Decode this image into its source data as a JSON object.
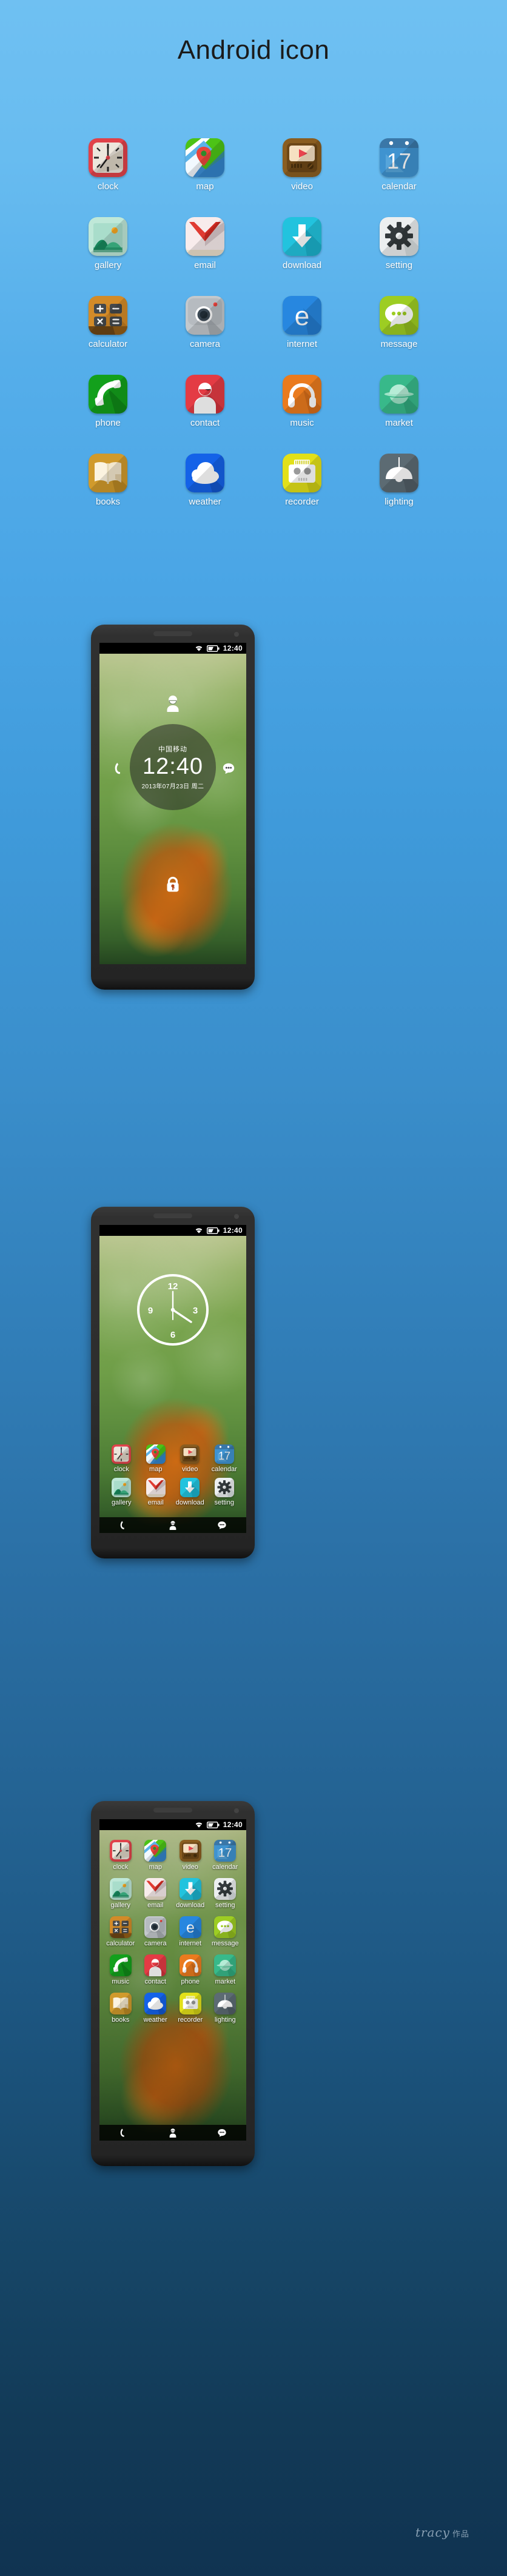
{
  "page": {
    "title": "Android icon",
    "signature": "tracy",
    "signature_suffix": "作品",
    "bg_top_color": "#6fc0f2",
    "bg_bottom_color": "#103351"
  },
  "icon_grid": {
    "rows": [
      [
        {
          "label": "clock",
          "icon": "clock-icon"
        },
        {
          "label": "map",
          "icon": "map-icon"
        },
        {
          "label": "video",
          "icon": "video-icon"
        },
        {
          "label": "calendar",
          "icon": "calendar-icon",
          "badge": "17"
        }
      ],
      [
        {
          "label": "gallery",
          "icon": "gallery-icon"
        },
        {
          "label": "email",
          "icon": "email-icon"
        },
        {
          "label": "download",
          "icon": "download-icon"
        },
        {
          "label": "setting",
          "icon": "setting-icon"
        }
      ],
      [
        {
          "label": "calculator",
          "icon": "calculator-icon"
        },
        {
          "label": "camera",
          "icon": "camera-icon"
        },
        {
          "label": "internet",
          "icon": "internet-icon"
        },
        {
          "label": "message",
          "icon": "message-icon"
        }
      ],
      [
        {
          "label": "phone",
          "icon": "phone-icon"
        },
        {
          "label": "contact",
          "icon": "contact-icon"
        },
        {
          "label": "music",
          "icon": "music-icon"
        },
        {
          "label": "market",
          "icon": "market-icon"
        }
      ],
      [
        {
          "label": "books",
          "icon": "books-icon"
        },
        {
          "label": "weather",
          "icon": "weather-icon"
        },
        {
          "label": "recorder",
          "icon": "recorder-icon"
        },
        {
          "label": "lighting",
          "icon": "lighting-icon"
        }
      ]
    ]
  },
  "status_bar": {
    "time": "12:40",
    "wifi_icon": "wifi-icon",
    "battery_icon": "battery-half-icon"
  },
  "phone_lockscreen": {
    "carrier": "中国移动",
    "time": "12:40",
    "date": "2013年07月23日  周二",
    "avatar_icon": "user-avatar-icon",
    "left_shortcut_icon": "phone-handset-icon",
    "right_shortcut_icon": "message-bubble-icon",
    "unlock_icon": "lock-icon"
  },
  "phone_home": {
    "widget": {
      "type": "analog-clock",
      "marks": [
        "12",
        "3",
        "6",
        "9"
      ],
      "hour_angle_deg": 120,
      "minute_angle_deg": 0
    },
    "apps": [
      {
        "label": "clock",
        "icon": "clock-icon"
      },
      {
        "label": "map",
        "icon": "map-icon"
      },
      {
        "label": "video",
        "icon": "video-icon"
      },
      {
        "label": "calendar",
        "icon": "calendar-icon",
        "badge": "17"
      },
      {
        "label": "gallery",
        "icon": "gallery-icon"
      },
      {
        "label": "email",
        "icon": "email-icon"
      },
      {
        "label": "download",
        "icon": "download-icon"
      },
      {
        "label": "setting",
        "icon": "setting-icon"
      }
    ],
    "navbar": [
      {
        "name": "nav-phone",
        "icon": "phone-handset-icon"
      },
      {
        "name": "nav-contact",
        "icon": "user-avatar-icon"
      },
      {
        "name": "nav-message",
        "icon": "message-bubble-icon"
      }
    ]
  },
  "phone_drawer": {
    "apps": [
      {
        "label": "clock",
        "icon": "clock-icon"
      },
      {
        "label": "map",
        "icon": "map-icon"
      },
      {
        "label": "video",
        "icon": "video-icon"
      },
      {
        "label": "calendar",
        "icon": "calendar-icon",
        "badge": "17"
      },
      {
        "label": "gallery",
        "icon": "gallery-icon"
      },
      {
        "label": "email",
        "icon": "email-icon"
      },
      {
        "label": "download",
        "icon": "download-icon"
      },
      {
        "label": "setting",
        "icon": "setting-icon"
      },
      {
        "label": "calculator",
        "icon": "calculator-icon"
      },
      {
        "label": "camera",
        "icon": "camera-icon"
      },
      {
        "label": "internet",
        "icon": "internet-icon"
      },
      {
        "label": "message",
        "icon": "message-icon"
      },
      {
        "label": "music",
        "icon": "music-icon"
      },
      {
        "label": "contact",
        "icon": "contact-icon"
      },
      {
        "label": "phone",
        "icon": "phone-icon"
      },
      {
        "label": "market",
        "icon": "market-icon"
      },
      {
        "label": "books",
        "icon": "books-icon"
      },
      {
        "label": "weather",
        "icon": "weather-icon"
      },
      {
        "label": "recorder",
        "icon": "recorder-icon"
      },
      {
        "label": "lighting",
        "icon": "lighting-icon"
      }
    ],
    "navbar": [
      {
        "name": "nav-phone",
        "icon": "phone-handset-icon"
      },
      {
        "name": "nav-contact",
        "icon": "user-avatar-icon"
      },
      {
        "name": "nav-message",
        "icon": "message-bubble-icon"
      }
    ]
  },
  "colors": {
    "clock": "#e0424a",
    "map_green": "#4cc316",
    "video": "#8a5d20",
    "calendar": "#3f93d0",
    "gallery": "#bfe8d8",
    "email": "#f6e9e9",
    "download": "#22c3de",
    "setting": "#eceff0",
    "calculator": "#d38b28",
    "camera": "#b9bec2",
    "internet": "#2787e0",
    "message": "#9dcd23",
    "phone": "#13a01c",
    "contact": "#e43b44",
    "music": "#ea7b1e",
    "market": "#38b98a",
    "books": "#d09a2c",
    "weather": "#1462e8",
    "recorder": "#e2e019",
    "lighting": "#5c6b73"
  }
}
